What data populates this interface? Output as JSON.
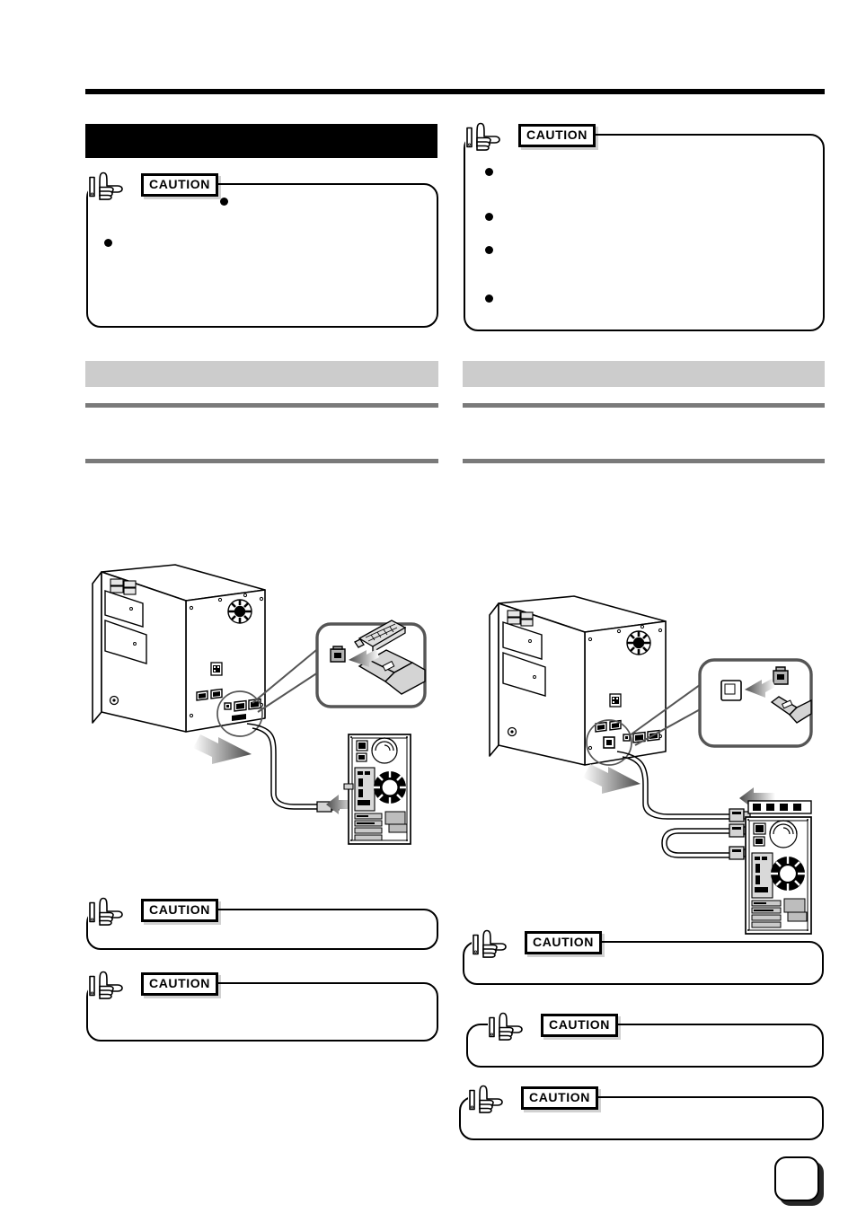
{
  "page": {
    "number": "",
    "top_rule": true
  },
  "left_column": {
    "section_title": "",
    "caution_top": {
      "label": "CAUTION",
      "icon": "pointing-hand-icon",
      "bullets": [
        "",
        ""
      ]
    },
    "gray_header": "",
    "paragraphs": [
      "",
      ""
    ],
    "illustration": {
      "name": "printer-rear-usb-connection-diagram",
      "caption": "",
      "parts": [
        "printer-rear-view",
        "usb-port-callout-circle",
        "magnified-connector-inset",
        "usb-b-connector",
        "parallel-connector",
        "usb-cable",
        "pc-tower-rear-view",
        "arrow-indicator"
      ]
    },
    "caution_bottom": [
      {
        "label": "CAUTION",
        "icon": "pointing-hand-icon",
        "text": ""
      },
      {
        "label": "CAUTION",
        "icon": "pointing-hand-icon",
        "text": ""
      }
    ]
  },
  "right_column": {
    "caution_top": {
      "label": "CAUTION",
      "icon": "pointing-hand-icon",
      "bullets": [
        "",
        "",
        "",
        ""
      ]
    },
    "gray_header": "",
    "paragraphs": [
      "",
      ""
    ],
    "illustration": {
      "name": "printer-rear-parallel-connection-diagram",
      "caption": "",
      "parts": [
        "printer-rear-view",
        "parallel-port-callout-circle",
        "magnified-connector-inset",
        "parallel-connector",
        "interface-cable",
        "pc-tower-rear-view",
        "arrow-indicator"
      ]
    },
    "caution_bottom": [
      {
        "label": "CAUTION",
        "icon": "pointing-hand-icon",
        "text": ""
      },
      {
        "label": "CAUTION",
        "icon": "pointing-hand-icon",
        "text": ""
      },
      {
        "label": "CAUTION",
        "icon": "pointing-hand-icon",
        "text": ""
      }
    ]
  },
  "colors": {
    "rule_black": "#000000",
    "gray_header_bg": "#cccccc",
    "gray_rule": "#7a7a7a",
    "illustration_fill": "#d9d9d9"
  }
}
